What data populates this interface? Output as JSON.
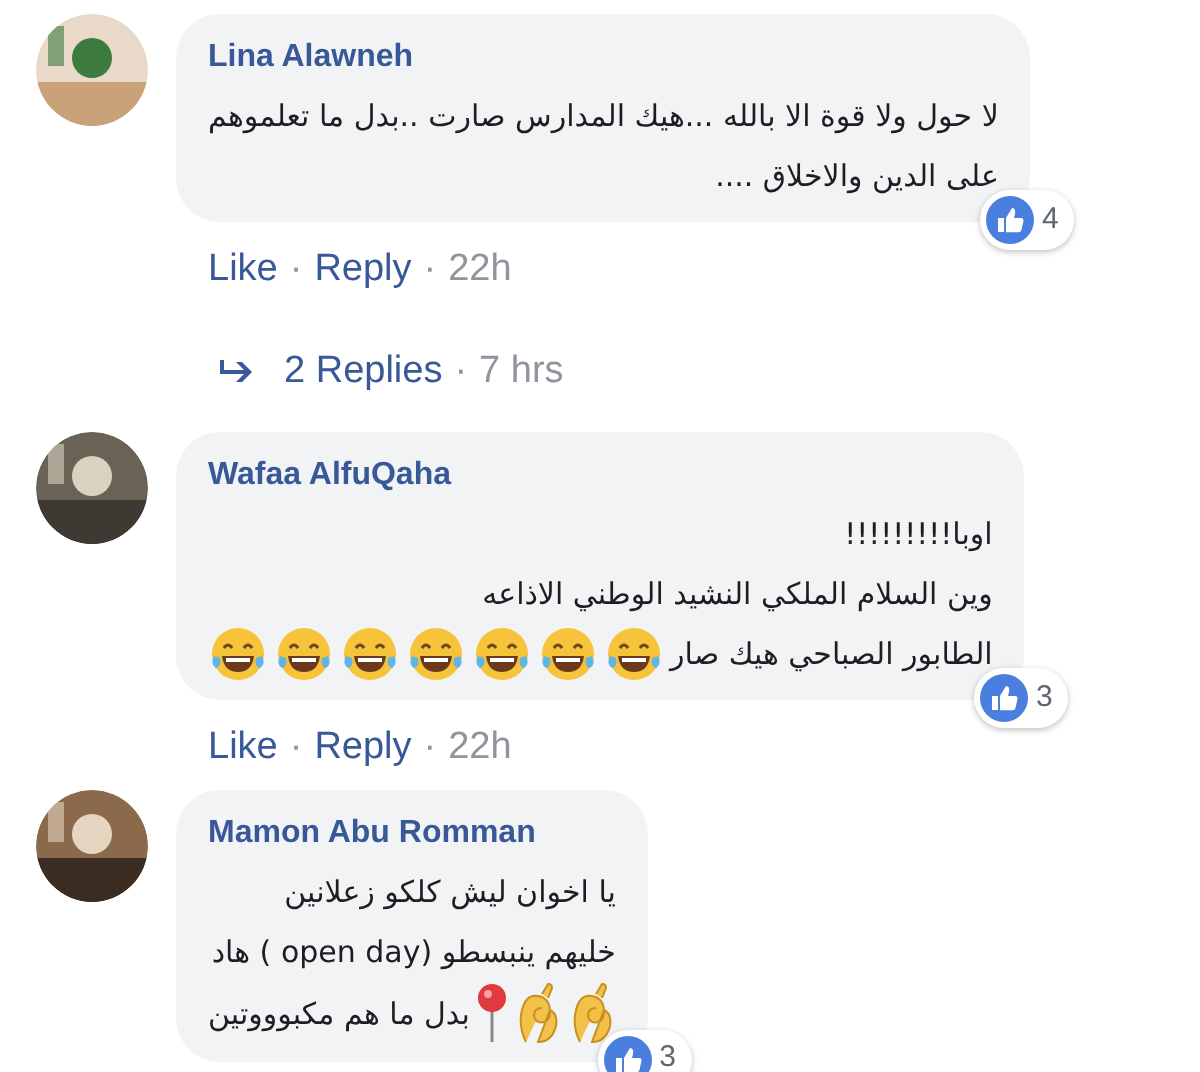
{
  "comments": [
    {
      "author": "Lina Alawneh",
      "lines": [
        [
          {
            "kind": "text",
            "text": "لا حول ولا قوة الا بالله ...هيك المدارس صارت ..بدل ما تعلموهم"
          }
        ],
        [
          {
            "kind": "text",
            "text": "على الدين والاخلاق ...."
          }
        ]
      ],
      "reaction_count": "4",
      "like": "Like",
      "sep1": "·",
      "reply": "Reply",
      "sep2": "·",
      "time": "22h",
      "replies": {
        "label": "2 Replies",
        "sep": "·",
        "time": "7 hrs"
      }
    },
    {
      "author": "Wafaa AlfuQaha",
      "lines": [
        [
          {
            "kind": "text",
            "text": "اوبا!!!!!!!!!"
          }
        ],
        [
          {
            "kind": "text",
            "text": "وين السلام الملكي النشيد الوطني الاذاعه"
          }
        ],
        [
          {
            "kind": "text",
            "text": "الطابور الصباحي هيك صار"
          },
          {
            "kind": "laugh"
          },
          {
            "kind": "laugh"
          },
          {
            "kind": "laugh"
          },
          {
            "kind": "laugh"
          },
          {
            "kind": "laugh"
          },
          {
            "kind": "laugh"
          },
          {
            "kind": "laugh"
          }
        ]
      ],
      "reaction_count": "3",
      "like": "Like",
      "sep1": "·",
      "reply": "Reply",
      "sep2": "·",
      "time": "22h"
    },
    {
      "author": "Mamon Abu Romman",
      "lines": [
        [
          {
            "kind": "text",
            "text": "يا اخوان ليش كلكو زعلانين"
          }
        ],
        [
          {
            "kind": "text",
            "text": "خليهم ينبسطو (open day ) هاد"
          }
        ],
        [
          {
            "kind": "ok"
          },
          {
            "kind": "ok"
          },
          {
            "kind": "pin"
          },
          {
            "kind": "text",
            "text": "بدل ما هم مكبوووتين"
          }
        ]
      ],
      "reaction_count": "3"
    }
  ]
}
